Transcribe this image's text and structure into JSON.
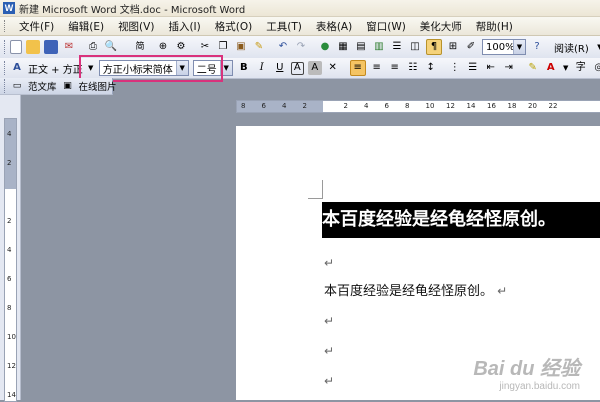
{
  "window": {
    "title": "新建 Microsoft Word 文档.doc - Microsoft Word"
  },
  "menu": [
    "文件(F)",
    "编辑(E)",
    "视图(V)",
    "插入(I)",
    "格式(O)",
    "工具(T)",
    "表格(A)",
    "窗口(W)",
    "美化大师",
    "帮助(H)"
  ],
  "standard_toolbar": {
    "zoom": "100%",
    "read_label": "阅读(R)"
  },
  "format_toolbar": {
    "style": "正文 + 方正",
    "font": "方正小标宋简体",
    "size": "二号",
    "bold": "B",
    "italic": "I",
    "underline": "U",
    "charborder": "A",
    "charshade": "A"
  },
  "extra_toolbar": {
    "fanwenku": "范文库",
    "online_pic": "在线图片"
  },
  "ruler": {
    "h_ticks": [
      "8",
      "6",
      "4",
      "2",
      "",
      "2",
      "4",
      "6",
      "8",
      "10",
      "12",
      "14",
      "16",
      "18",
      "20",
      "22"
    ],
    "v_ticks": [
      "4",
      "2",
      "",
      "2",
      "4",
      "6",
      "8",
      "10",
      "12",
      "14"
    ]
  },
  "document": {
    "heading": "本百度经验是经龟经怪原创。",
    "body": "本百度经验是经龟经怪原创。",
    "para_mark": "↵"
  },
  "watermark": {
    "brand": "Bai du 经验",
    "url": "jingyan.baidu.com"
  },
  "colors": {
    "highlight_box": "#d9327c",
    "selection": "#000000"
  }
}
